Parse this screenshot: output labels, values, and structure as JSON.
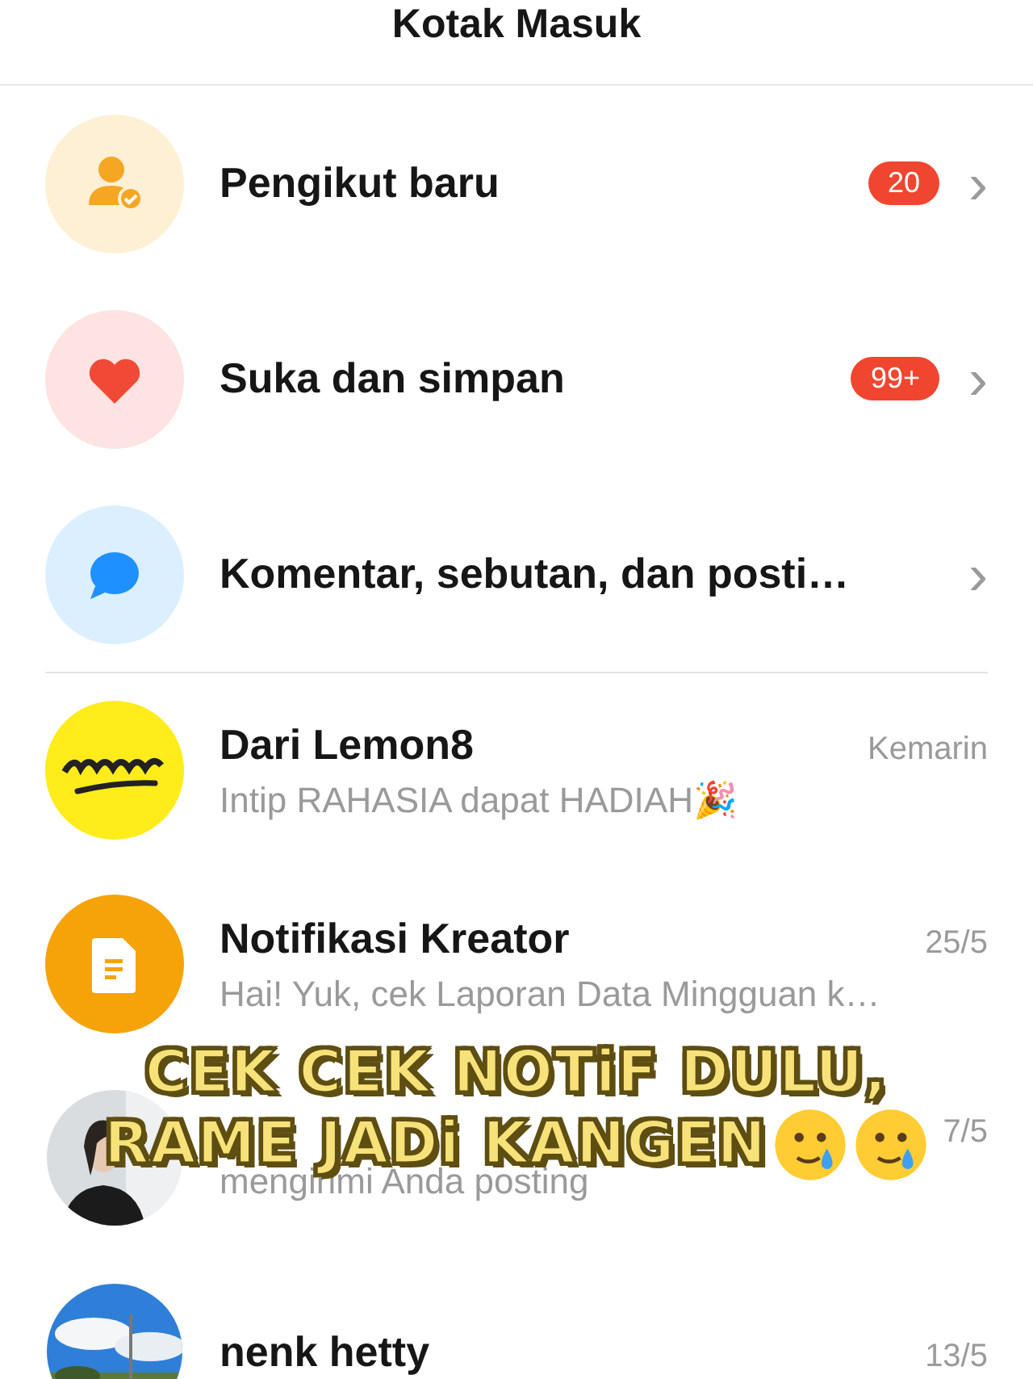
{
  "header": {
    "title": "Kotak Masuk"
  },
  "categories": [
    {
      "kind": "followers",
      "label": "Pengikut baru",
      "badge": "20"
    },
    {
      "kind": "likes",
      "label": "Suka dan simpan",
      "badge": "99+"
    },
    {
      "kind": "comments",
      "label": "Komentar, sebutan, dan posti…"
    }
  ],
  "chevron": "›",
  "messages": [
    {
      "kind": "lemon",
      "name": "Dari Lemon8",
      "time": "Kemarin",
      "preview": "Intip RAHASIA dapat HADIAH🎉"
    },
    {
      "kind": "doc",
      "name": "Notifikasi Kreator",
      "time": "25/5",
      "preview": "Hai! Yuk, cek Laporan Data Mingguan k…"
    },
    {
      "kind": "picture",
      "time": "7/5",
      "preview": "mengirimi Anda posting"
    },
    {
      "kind": "picture",
      "name": "nenk hetty",
      "time": "13/5"
    }
  ],
  "caption": {
    "lines": [
      "CEK CEK NOTiF DULU,",
      "RAME JADi KANGEN"
    ],
    "emojis": [
      {
        "kind": "tearful_smile"
      },
      {
        "kind": "tearful_smile"
      }
    ]
  }
}
